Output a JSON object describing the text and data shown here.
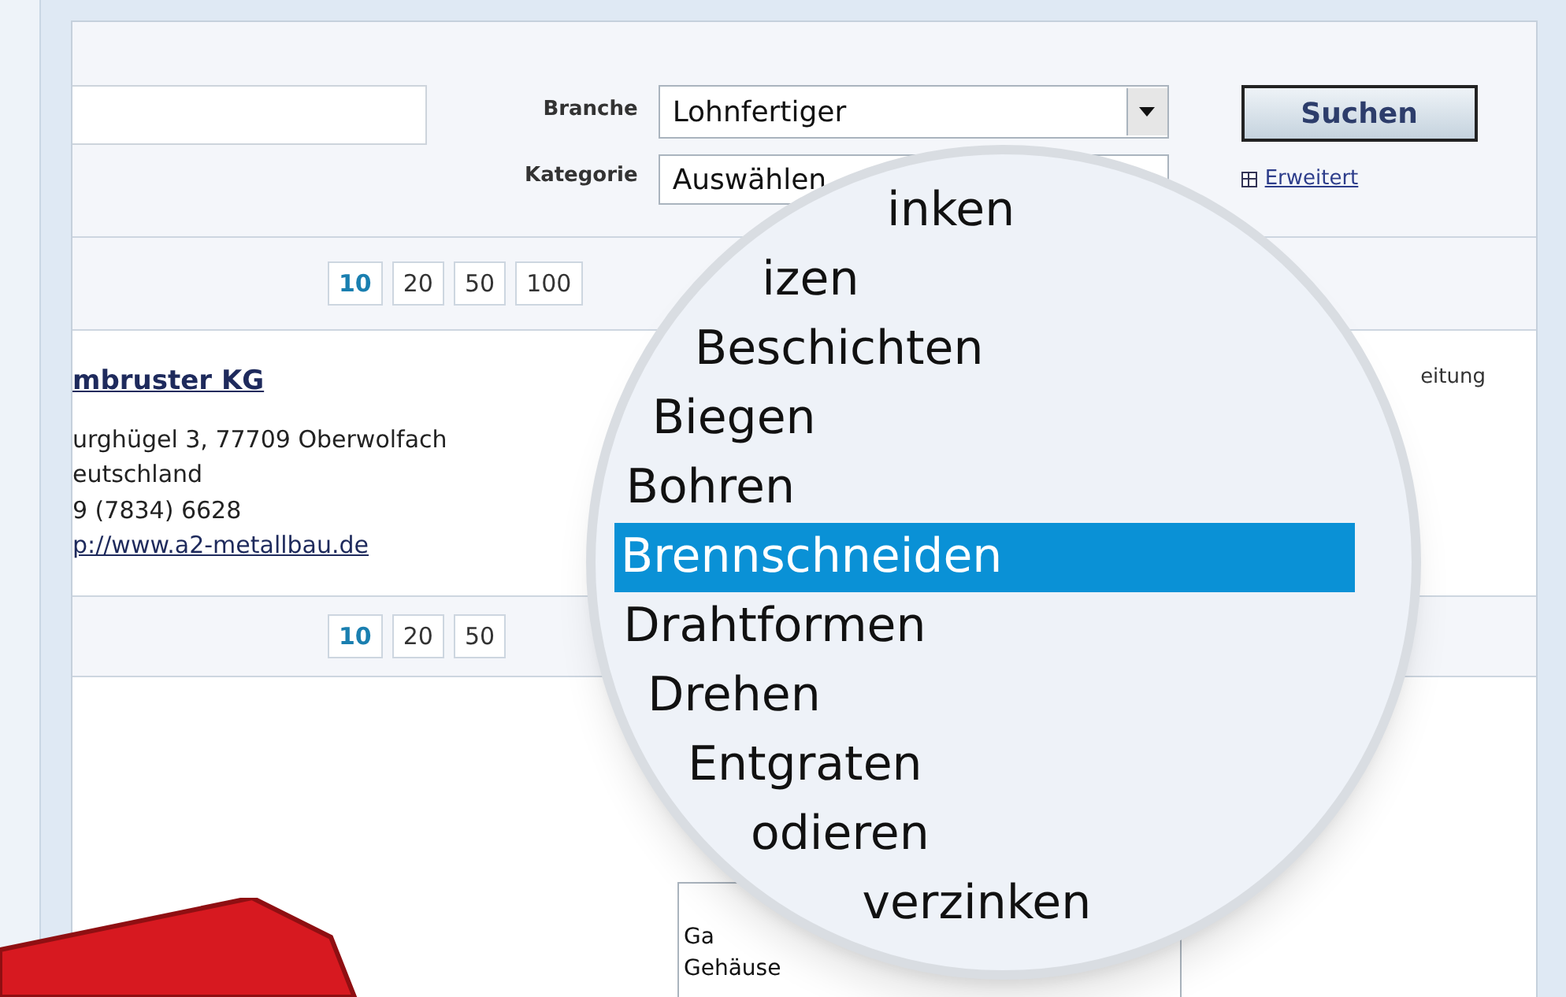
{
  "search": {
    "branche_label": "Branche",
    "branche_value": "Lohnfertiger",
    "kategorie_label": "Kategorie",
    "kategorie_value": "Auswählen",
    "button": "Suchen",
    "advanced_link": "Erweitert"
  },
  "page_sizes_top": [
    {
      "label": "10",
      "selected": true
    },
    {
      "label": "20",
      "selected": false
    },
    {
      "label": "50",
      "selected": false
    },
    {
      "label": "100",
      "selected": false
    }
  ],
  "result": {
    "name": "mbruster KG",
    "address": "urghügel 3, 77709 Oberwolfach",
    "country": "eutschland",
    "phone": "9 (7834) 6628",
    "url": "p://www.a2-metallbau.de",
    "column_3": "eitung"
  },
  "page_sizes_bottom": [
    {
      "label": "10",
      "selected": true
    },
    {
      "label": "20",
      "selected": false
    },
    {
      "label": "50",
      "selected": false
    }
  ],
  "dropdown_visible_options": [
    "Ga",
    "Gehäuse"
  ],
  "magnified_options": [
    {
      "label": "inken",
      "selected": false
    },
    {
      "label": "izen",
      "selected": false
    },
    {
      "label": "Beschichten",
      "selected": false
    },
    {
      "label": "Biegen",
      "selected": false
    },
    {
      "label": "Bohren",
      "selected": false
    },
    {
      "label": "Brennschneiden",
      "selected": true
    },
    {
      "label": "Drahtformen",
      "selected": false
    },
    {
      "label": "Drehen",
      "selected": false
    },
    {
      "label": "Entgraten",
      "selected": false
    },
    {
      "label": "odieren",
      "selected": false
    },
    {
      "label": "verzinken",
      "selected": false
    }
  ]
}
